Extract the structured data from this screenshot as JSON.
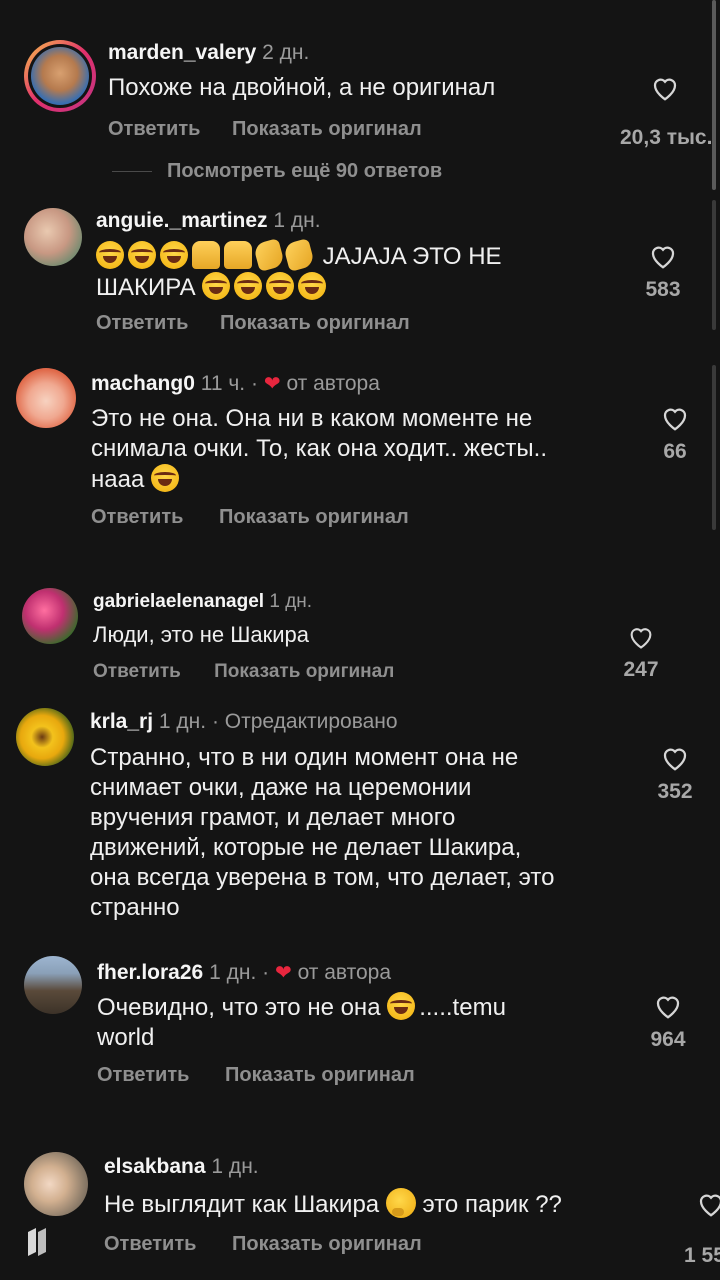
{
  "labels": {
    "reply": "Ответить",
    "show_original": "Показать оригинал",
    "more_replies": "Посмотреть ещё 90 ответов",
    "from_author": "от автора",
    "edited": "Отредактировано"
  },
  "comments": [
    {
      "user": "marden_valery",
      "time": "2 дн.",
      "text": "Похоже на двойной, а не оригинал",
      "likes": "20,3 тыс."
    },
    {
      "user": "anguie._martinez",
      "time": "1 дн.",
      "text_pre": "",
      "text_a": "JAJAJA ЭТО НЕ",
      "text_b": "ШАКИРА",
      "likes": "583"
    },
    {
      "user": "machang0",
      "time": "11 ч.",
      "text_1": "Это не она. Она ни в каком моменте не",
      "text_2": "снимала очки. То, как она ходит.. жесты..",
      "text_3": "нааа",
      "likes": "66"
    },
    {
      "user": "gabrielaelenanagel",
      "time": "1 дн.",
      "text": "Люди, это не Шакира",
      "likes": "247"
    },
    {
      "user": "krla_rj",
      "time": "1 дн.",
      "text_1": "Странно, что в ни один момент она не",
      "text_2": "снимает очки, даже на церемонии",
      "text_3": "вручения грамот, и делает много",
      "text_4": "движений, которые не делает Шакира,",
      "text_5": "она всегда уверена в том, что делает, это",
      "text_6": "странно",
      "likes": "352"
    },
    {
      "user": "fher.lora26",
      "time": "1 дн.",
      "text_1": "Очевидно, что это не она",
      "text_1b": ".....temu",
      "text_2": "world",
      "likes": "964"
    },
    {
      "user": "elsakbana",
      "time": "1 дн.",
      "text_1": "Не выглядит как Шакира",
      "text_2": "это парик ??",
      "likes": "1 55"
    }
  ],
  "colors": {
    "background": "#141414",
    "heart": "#e8263e",
    "muted": "#8f8f8f"
  },
  "icons": [
    "heart-outline-icon",
    "heart-filled-icon",
    "laughing-face-emoji",
    "raised-hands-emoji",
    "clapping-hands-emoji",
    "thinking-face-emoji",
    "app-logo-icon"
  ]
}
